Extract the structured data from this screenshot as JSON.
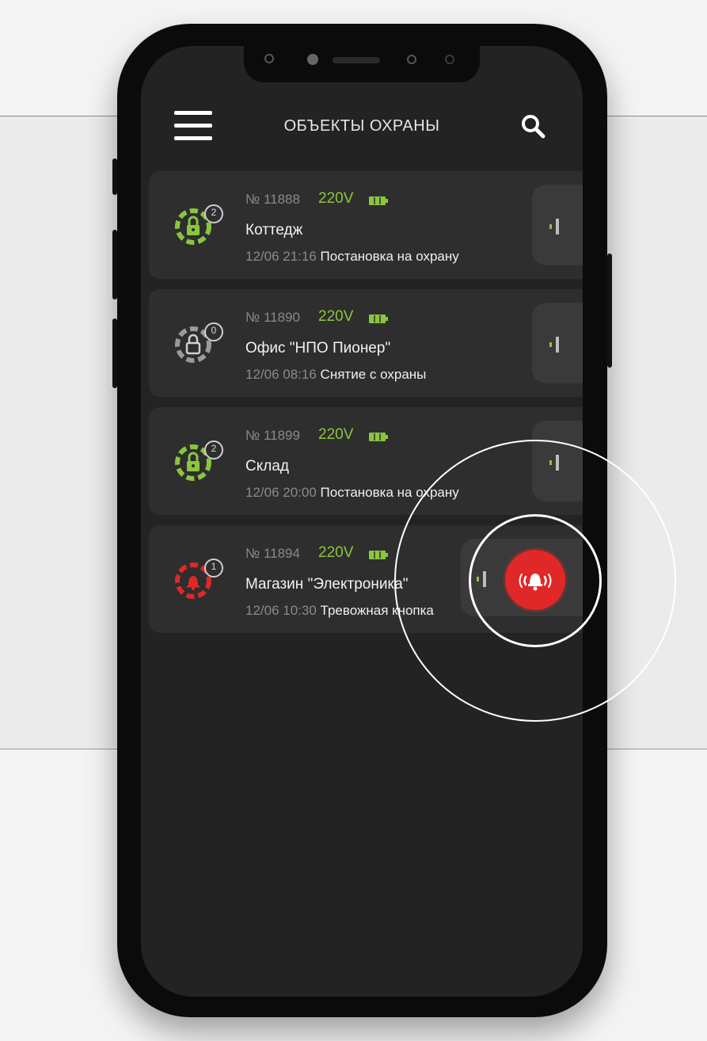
{
  "header": {
    "title": "ОБЪЕКТЫ ОХРАНЫ",
    "menu_icon": "menu-icon",
    "search_icon": "search-icon"
  },
  "colors": {
    "armed": "#8bc53f",
    "disarmed": "#9a9a9a",
    "alarm": "#e02828",
    "card": "#2e2e2e",
    "screen": "#232323"
  },
  "objects": [
    {
      "number": "№ 11888",
      "voltage": "220V",
      "badge": "2",
      "name": "Коттедж",
      "time": "12/06 21:16",
      "event": "Постановка на охрану",
      "status": "armed"
    },
    {
      "number": "№ 11890",
      "voltage": "220V",
      "badge": "0",
      "name": "Офис \"НПО Пионер\"",
      "time": "12/06 08:16",
      "event": "Снятие с охраны",
      "status": "disarmed"
    },
    {
      "number": "№ 11899",
      "voltage": "220V",
      "badge": "2",
      "name": "Склад",
      "time": "12/06 20:00",
      "event": "Постановка на охрану",
      "status": "armed"
    },
    {
      "number": "№ 11894",
      "voltage": "220V",
      "badge": "1",
      "name": "Магазин \"Электроника\"",
      "time": "12/06 10:30",
      "event": "Тревожная кнопка",
      "status": "alarm"
    }
  ]
}
